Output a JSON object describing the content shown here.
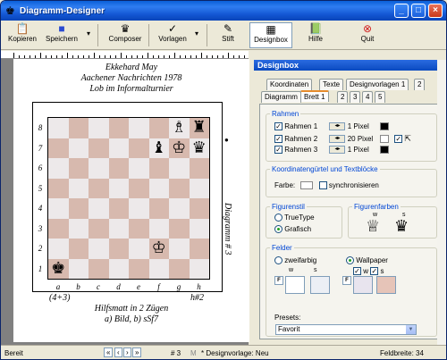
{
  "window": {
    "title": "Diagramm-Designer",
    "minimize": "_",
    "maximize": "□",
    "close": "×"
  },
  "toolbar": {
    "kopieren": "Kopieren",
    "speichern": "Speichern",
    "composer": "Composer",
    "vorlagen": "Vorlagen",
    "stift": "Stift",
    "designbox": "Designbox",
    "hilfe": "Hilfe",
    "quit": "Quit"
  },
  "diagram": {
    "header": [
      "Ekkehard May",
      "Aachener Nachrichten 1978",
      "Lob im Informalturnier"
    ],
    "ranks": [
      "8",
      "7",
      "6",
      "5",
      "4",
      "3",
      "2",
      "1"
    ],
    "files": [
      "a",
      "b",
      "c",
      "d",
      "e",
      "f",
      "g",
      "h"
    ],
    "side_label": "Diagramm # 3",
    "to_move_marker": "●",
    "footer_left": "(4+3)",
    "footer_right": "h#2",
    "footer_line2": "Hilfsmatt in 2 Zügen",
    "footer_line3": "a) Bild, b) sSf7",
    "pieces": [
      {
        "square": "g8",
        "glyph": "♗"
      },
      {
        "square": "h8",
        "glyph": "♜"
      },
      {
        "square": "f7",
        "glyph": "♝"
      },
      {
        "square": "g7",
        "glyph": "♔"
      },
      {
        "square": "h7",
        "glyph": "♛"
      },
      {
        "square": "f2",
        "glyph": "♔"
      },
      {
        "square": "a1",
        "glyph": "♚"
      }
    ]
  },
  "panel": {
    "title": "Designbox",
    "tabs_row1": [
      "Koordinaten",
      "Texte",
      "Designvorlagen 1",
      "2"
    ],
    "tabs_row2": [
      "Diagramm",
      "Brett 1",
      "2",
      "3",
      "4",
      "5"
    ],
    "rahmen": {
      "legend": "Rahmen",
      "rows": [
        {
          "label": "Rahmen 1",
          "checked": true,
          "value": "1 Pixel",
          "color": "#000000"
        },
        {
          "label": "Rahmen 2",
          "checked": true,
          "value": "20 Pixel",
          "color": "#ffffff"
        },
        {
          "label": "Rahmen 3",
          "checked": true,
          "value": "1 Pixel",
          "color": "#000000"
        }
      ]
    },
    "koordinaten": {
      "legend": "Koordinatengürtel und Textblöcke",
      "farbe_label": "Farbe:",
      "sync_label": "synchronisieren"
    },
    "figurenstil": {
      "legend": "Figurenstil",
      "options": [
        "TrueType",
        "Grafisch"
      ],
      "selected": "Grafisch"
    },
    "figurenfarben": {
      "legend": "Figurenfarben",
      "w": "w",
      "s": "s"
    },
    "felder": {
      "legend": "Felder",
      "options": [
        "zweifarbig",
        "Wallpaper"
      ],
      "selected": "Wallpaper",
      "w": "w",
      "s": "s",
      "f_label": "F",
      "presets_label": "Presets:",
      "preset_value": "Favorit"
    }
  },
  "status": {
    "ready": "Bereit",
    "nav_first": "«",
    "nav_prev": "‹",
    "nav_next": "›",
    "nav_last": "»",
    "diagram_no": "# 3",
    "m": "M",
    "template": "* Designvorlage: Neu",
    "fieldwidth": "Feldbreite: 34"
  }
}
